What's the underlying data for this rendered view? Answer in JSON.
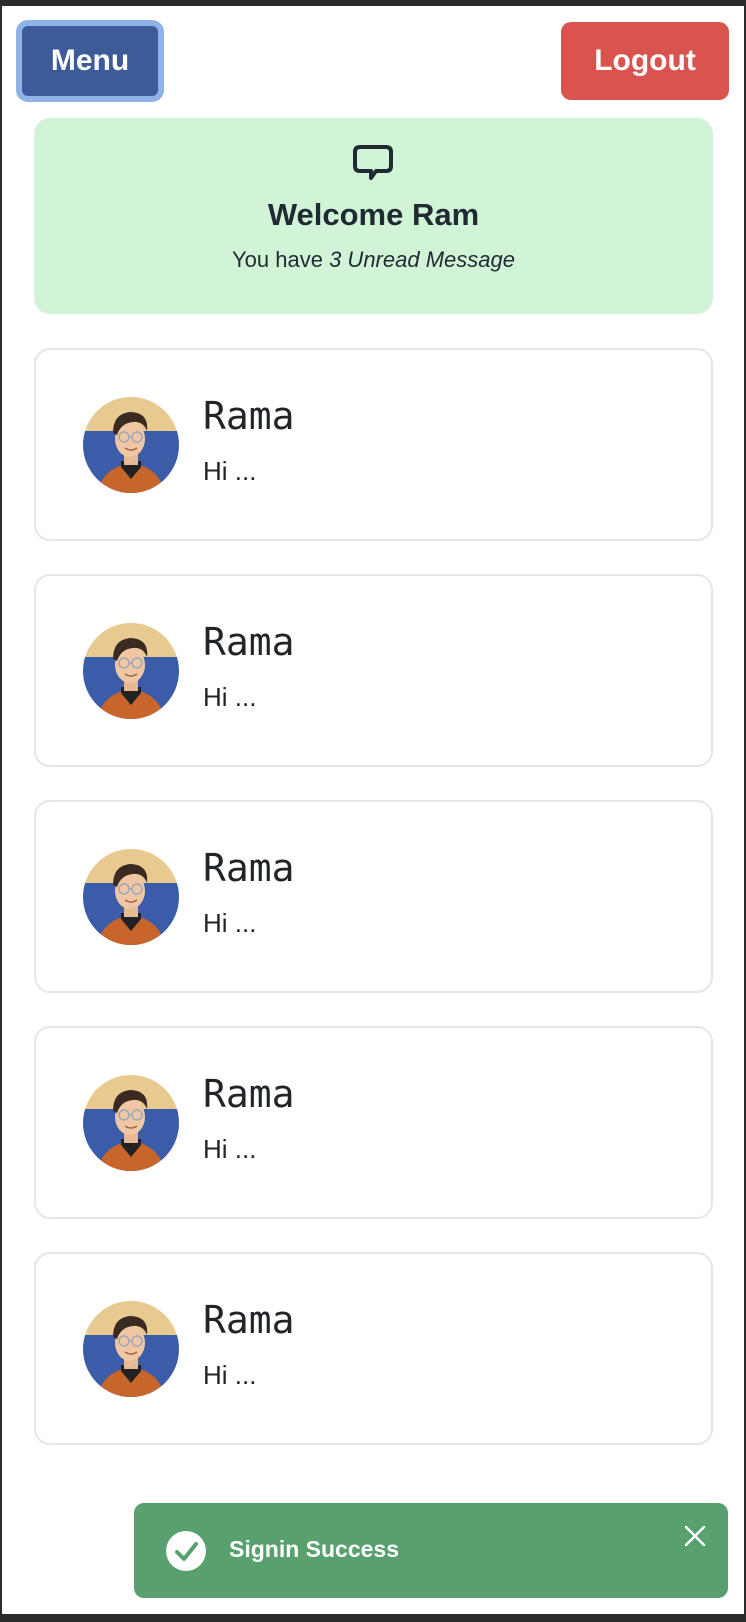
{
  "header": {
    "menu_label": "Menu",
    "logout_label": "Logout"
  },
  "welcome": {
    "icon": "chat-bubble-icon",
    "title": "Welcome Ram",
    "subtitle_prefix": "You have ",
    "subtitle_emphasis": "3 Unread Message"
  },
  "messages": [
    {
      "name": "Rama",
      "preview": "Hi ..."
    },
    {
      "name": "Rama",
      "preview": "Hi ..."
    },
    {
      "name": "Rama",
      "preview": "Hi ..."
    },
    {
      "name": "Rama",
      "preview": "Hi ..."
    },
    {
      "name": "Rama",
      "preview": "Hi ..."
    }
  ],
  "toast": {
    "icon": "check-circle-icon",
    "message": "Signin Success",
    "close_icon": "close-icon",
    "color": "#58a06e"
  },
  "colors": {
    "menu_button": "#3d5a99",
    "logout_button": "#d9534f",
    "welcome_background": "#d1f4d7"
  }
}
